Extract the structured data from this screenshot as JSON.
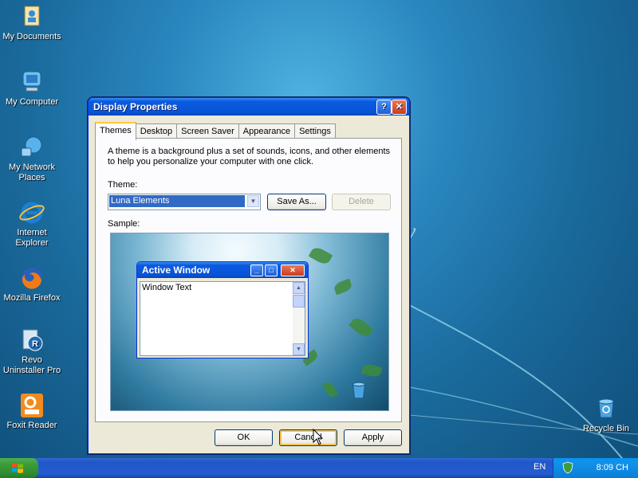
{
  "desktop": {
    "icons": [
      {
        "label": "My Documents",
        "icon": "my-documents-icon"
      },
      {
        "label": "My Computer",
        "icon": "my-computer-icon"
      },
      {
        "label": "My Network Places",
        "icon": "network-places-icon"
      },
      {
        "label": "Internet Explorer",
        "icon": "internet-explorer-icon"
      },
      {
        "label": "Mozilla Firefox",
        "icon": "firefox-icon"
      },
      {
        "label": "Revo Uninstaller Pro",
        "icon": "revo-uninstaller-icon"
      },
      {
        "label": "Foxit Reader",
        "icon": "foxit-reader-icon"
      },
      {
        "label": "Recycle Bin",
        "icon": "recycle-bin-icon"
      }
    ]
  },
  "dialog": {
    "title": "Display Properties",
    "help_glyph": "?",
    "close_glyph": "✕",
    "tabs": [
      {
        "label": "Themes",
        "active": true
      },
      {
        "label": "Desktop",
        "active": false
      },
      {
        "label": "Screen Saver",
        "active": false
      },
      {
        "label": "Appearance",
        "active": false
      },
      {
        "label": "Settings",
        "active": false
      }
    ],
    "description": "A theme is a background plus a set of sounds, icons, and other elements to help you personalize your computer with one click.",
    "theme_label": "Theme:",
    "theme_value": "Luna Elements",
    "save_as_label": "Save As...",
    "delete_label": "Delete",
    "sample_label": "Sample:",
    "sample_window": {
      "title": "Active Window",
      "text": "Window Text"
    },
    "ok_label": "OK",
    "cancel_label": "Cancel",
    "apply_label": "Apply"
  },
  "taskbar": {
    "language": "EN",
    "clock": "8:09 CH"
  },
  "colors": {
    "title_bar": "#0854d8",
    "start_button": "#3c9c3c",
    "taskbar": "#245dd0"
  }
}
